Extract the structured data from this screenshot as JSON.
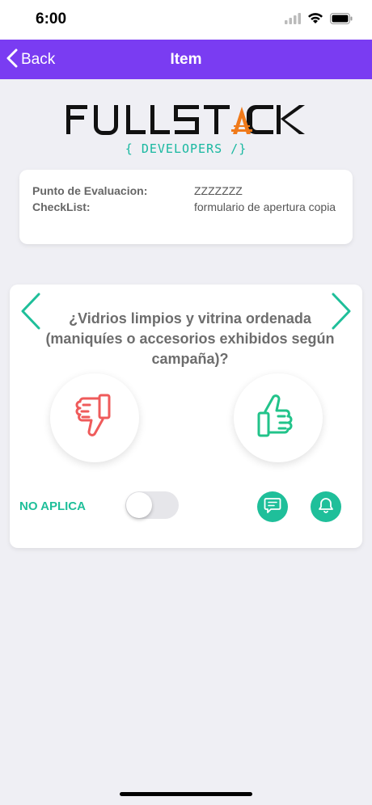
{
  "status_bar": {
    "time": "6:00"
  },
  "nav": {
    "back_label": "Back",
    "title": "Item"
  },
  "logo": {
    "main_text": "FULLSTACK",
    "sub_text": "{ DEVELOPERS /}"
  },
  "info": {
    "punto_label": "Punto de Evaluacion:",
    "punto_value": "ZZZZZZZ",
    "checklist_label": "CheckList:",
    "checklist_value": "formulario de apertura copia"
  },
  "question": {
    "text": "¿Vidrios limpios y vitrina ordenada (maniquíes o accesorios exhibidos según campaña)?",
    "no_aplica_label": "NO APLICA",
    "no_aplica_on": false
  },
  "colors": {
    "accent": "#7a3cf2",
    "teal": "#1fbf9a",
    "thumbs_down": "#ef5b5b",
    "thumbs_up": "#22c38a"
  }
}
